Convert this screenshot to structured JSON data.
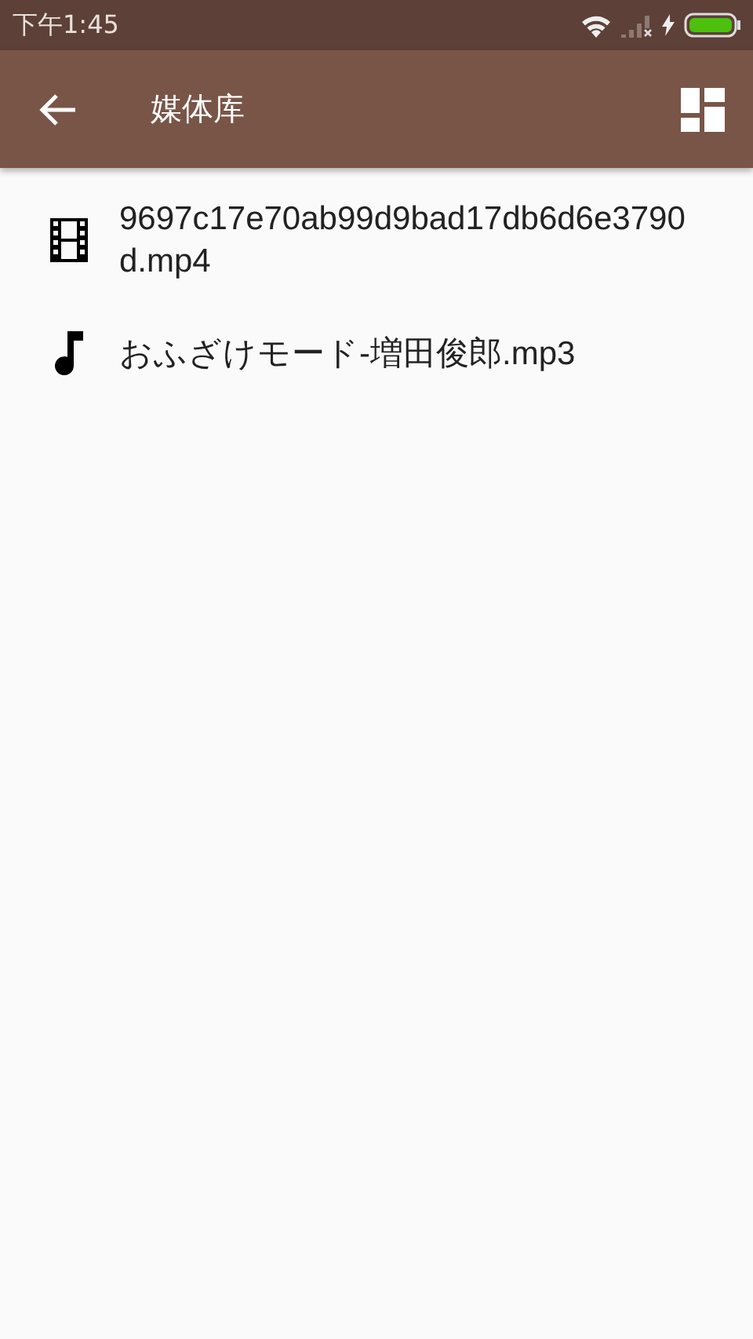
{
  "status_bar": {
    "time": "下午1:45"
  },
  "toolbar": {
    "title": "媒体库"
  },
  "items": [
    {
      "kind": "video",
      "name": "9697c17e70ab99d9bad17db6d6e3790d.mp4"
    },
    {
      "kind": "audio",
      "name": "おふざけモード-増田俊郎.mp3"
    }
  ]
}
